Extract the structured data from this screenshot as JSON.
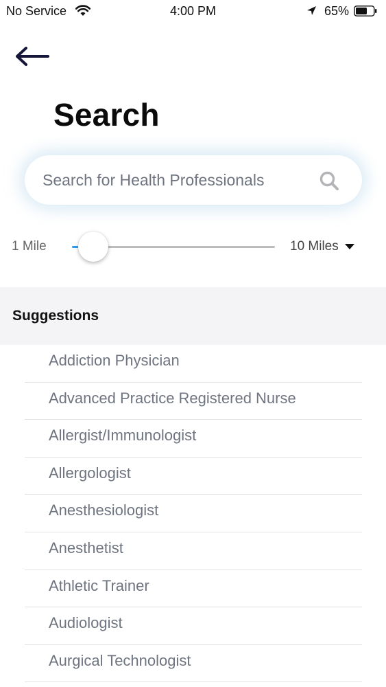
{
  "status_bar": {
    "carrier": "No Service",
    "time": "4:00 PM",
    "battery_percent": "65%",
    "battery_level": 0.65,
    "icons": [
      "wifi-icon",
      "location-arrow-icon",
      "battery-icon"
    ]
  },
  "header": {
    "back_icon": "back-arrow-icon",
    "title": "Search"
  },
  "search": {
    "placeholder": "Search for Health Professionals",
    "value": "",
    "icon": "search-icon"
  },
  "distance": {
    "min_label": "1 Mile",
    "max_label": "10 Miles",
    "current_fraction": 0.03,
    "accent_color": "#2a9df4"
  },
  "suggestions": {
    "title": "Suggestions",
    "items": [
      "Addiction Physician",
      "Advanced Practice Registered Nurse",
      "Allergist/Immunologist",
      "Allergologist",
      "Anesthesiologist",
      "Anesthetist",
      "Athletic Trainer",
      "Audiologist",
      "Aurgical Technologist"
    ]
  }
}
